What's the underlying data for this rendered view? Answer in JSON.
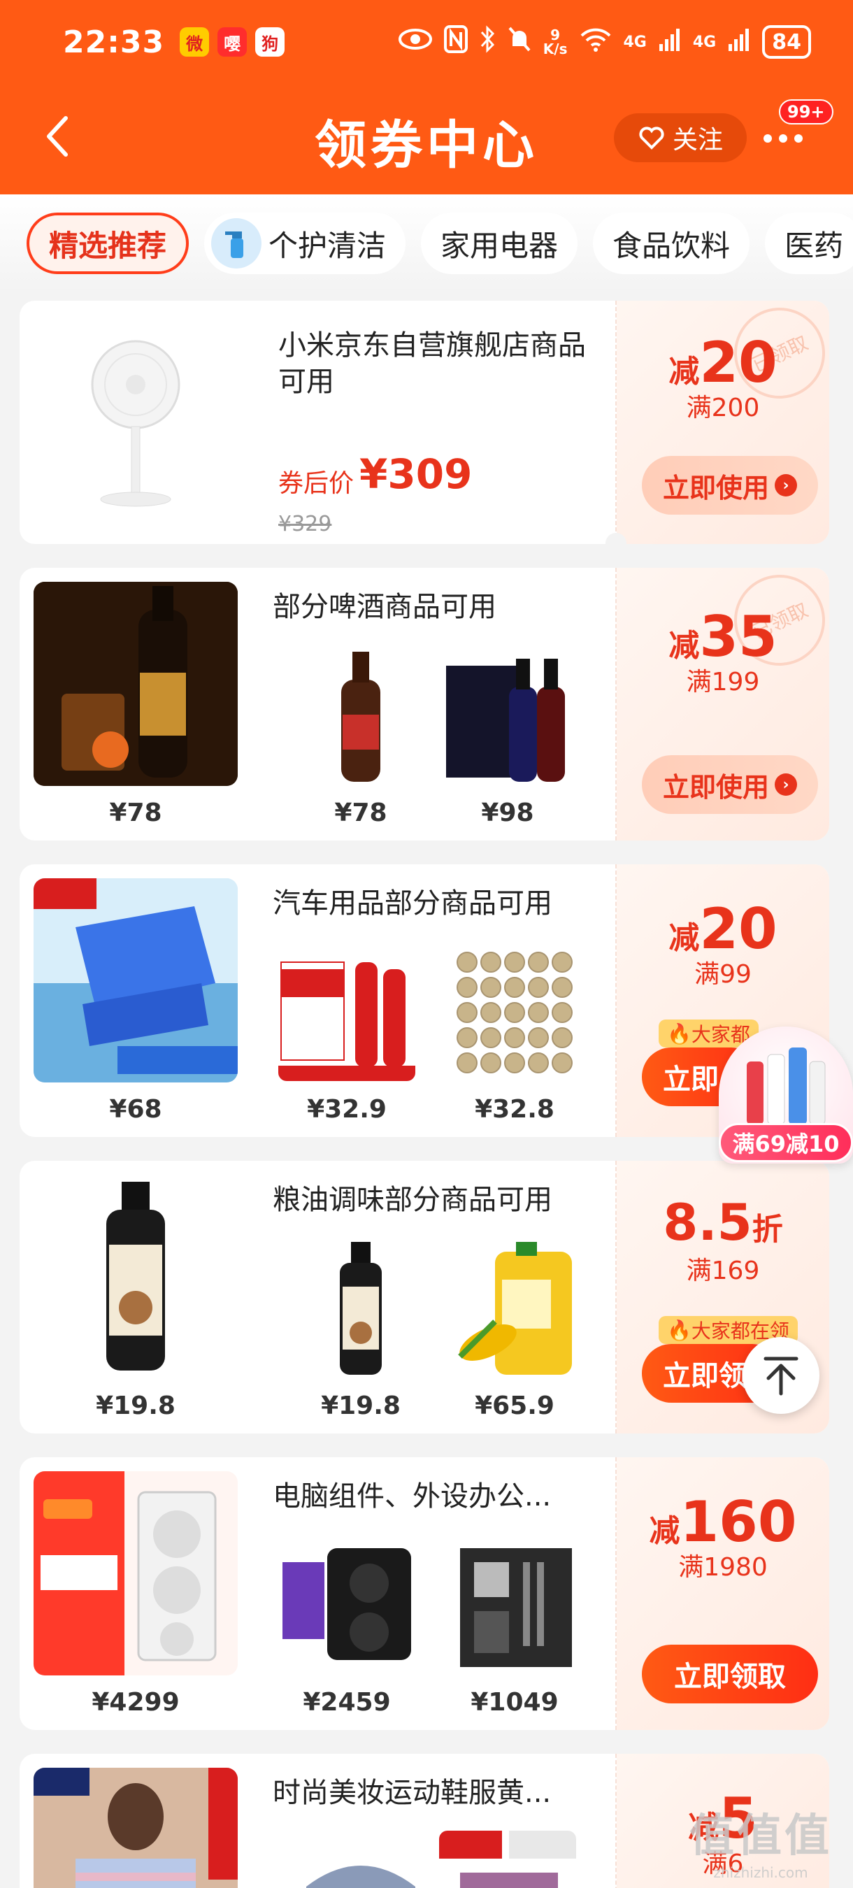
{
  "status_bar": {
    "time": "22:33",
    "app_icons": [
      "微",
      "嘤",
      "狗"
    ],
    "speed_value": "9",
    "speed_unit": "K/s",
    "net1": "4G",
    "net2": "4G",
    "battery": "84"
  },
  "header": {
    "back_icon": "chevron-left-icon",
    "title": "领券中心",
    "follow_label": "关注",
    "more_badge": "99+"
  },
  "tabs": [
    {
      "label": "精选推荐",
      "active": true
    },
    {
      "label": "个护清洁",
      "active": false
    },
    {
      "label": "家用电器",
      "active": false
    },
    {
      "label": "食品饮料",
      "active": false
    },
    {
      "label": "医药",
      "active": false
    }
  ],
  "cards": [
    {
      "desc": "小米京东自营旗舰店商品可用",
      "after_label": "券后价",
      "after_price": "¥309",
      "orig_price": "¥329",
      "coupon_prefix": "减",
      "coupon_value": "20",
      "threshold": "满200",
      "button": "立即使用",
      "stamp": "已领取"
    },
    {
      "desc": "部分啤酒商品可用",
      "prices": [
        "¥78",
        "¥78",
        "¥98"
      ],
      "coupon_prefix": "减",
      "coupon_value": "35",
      "threshold": "满199",
      "button": "立即使用",
      "stamp": "已领取"
    },
    {
      "desc": "汽车用品部分商品可用",
      "prices": [
        "¥68",
        "¥32.9",
        "¥32.8"
      ],
      "coupon_prefix": "减",
      "coupon_value": "20",
      "threshold": "满99",
      "hot_tag": "大家都",
      "button": "立即"
    },
    {
      "desc": "粮油调味部分商品可用",
      "prices": [
        "¥19.8",
        "¥19.8",
        "¥65.9"
      ],
      "coupon_value": "8.5",
      "coupon_suffix": "折",
      "threshold": "满169",
      "hot_tag": "大家都在领",
      "button": "立即领"
    },
    {
      "desc": "电脑组件、外设办公...",
      "prices": [
        "¥4299",
        "¥2459",
        "¥1049"
      ],
      "coupon_prefix": "减",
      "coupon_value": "160",
      "threshold": "满1980",
      "button": "立即领取"
    },
    {
      "desc": "时尚美妆运动鞋服黄...",
      "coupon_prefix": "减",
      "coupon_value": "5",
      "threshold": "满6"
    }
  ],
  "float_promo": {
    "label": "满69减10"
  },
  "watermark": {
    "big": "值值值",
    "small": "zhizhizhi.com"
  }
}
